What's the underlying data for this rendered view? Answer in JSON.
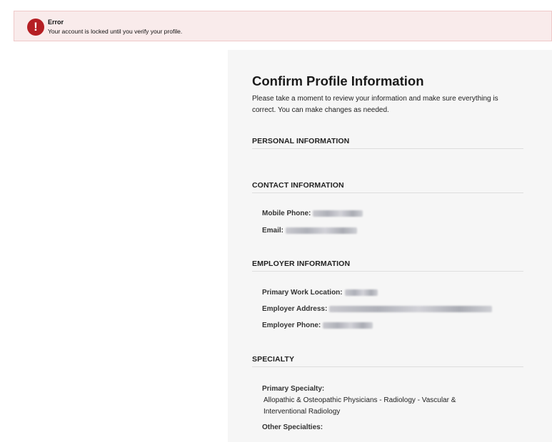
{
  "alert": {
    "icon": "exclamation-circle-icon",
    "icon_glyph": "!",
    "title": "Error",
    "message": "Your account is locked until you verify your profile.",
    "colors": {
      "background": "#f9ebeb",
      "icon": "#b51f24"
    }
  },
  "profile": {
    "title": "Confirm Profile Information",
    "intro": "Please take a moment to review your information and make sure everything is correct. You can make changes as needed.",
    "sections": {
      "personal": {
        "heading": "PERSONAL INFORMATION"
      },
      "contact": {
        "heading": "CONTACT INFORMATION",
        "mobile_label": "Mobile Phone:",
        "email_label": "Email:"
      },
      "employer": {
        "heading": "EMPLOYER INFORMATION",
        "location_label": "Primary Work Location:",
        "address_label": "Employer Address:",
        "phone_label": "Employer Phone:"
      },
      "specialty": {
        "heading": "SPECIALTY",
        "primary_label": "Primary Specialty:",
        "primary_value": "Allopathic & Osteopathic Physicians - Radiology - Vascular & Interventional Radiology",
        "other_label": "Other Specialties:"
      }
    }
  }
}
